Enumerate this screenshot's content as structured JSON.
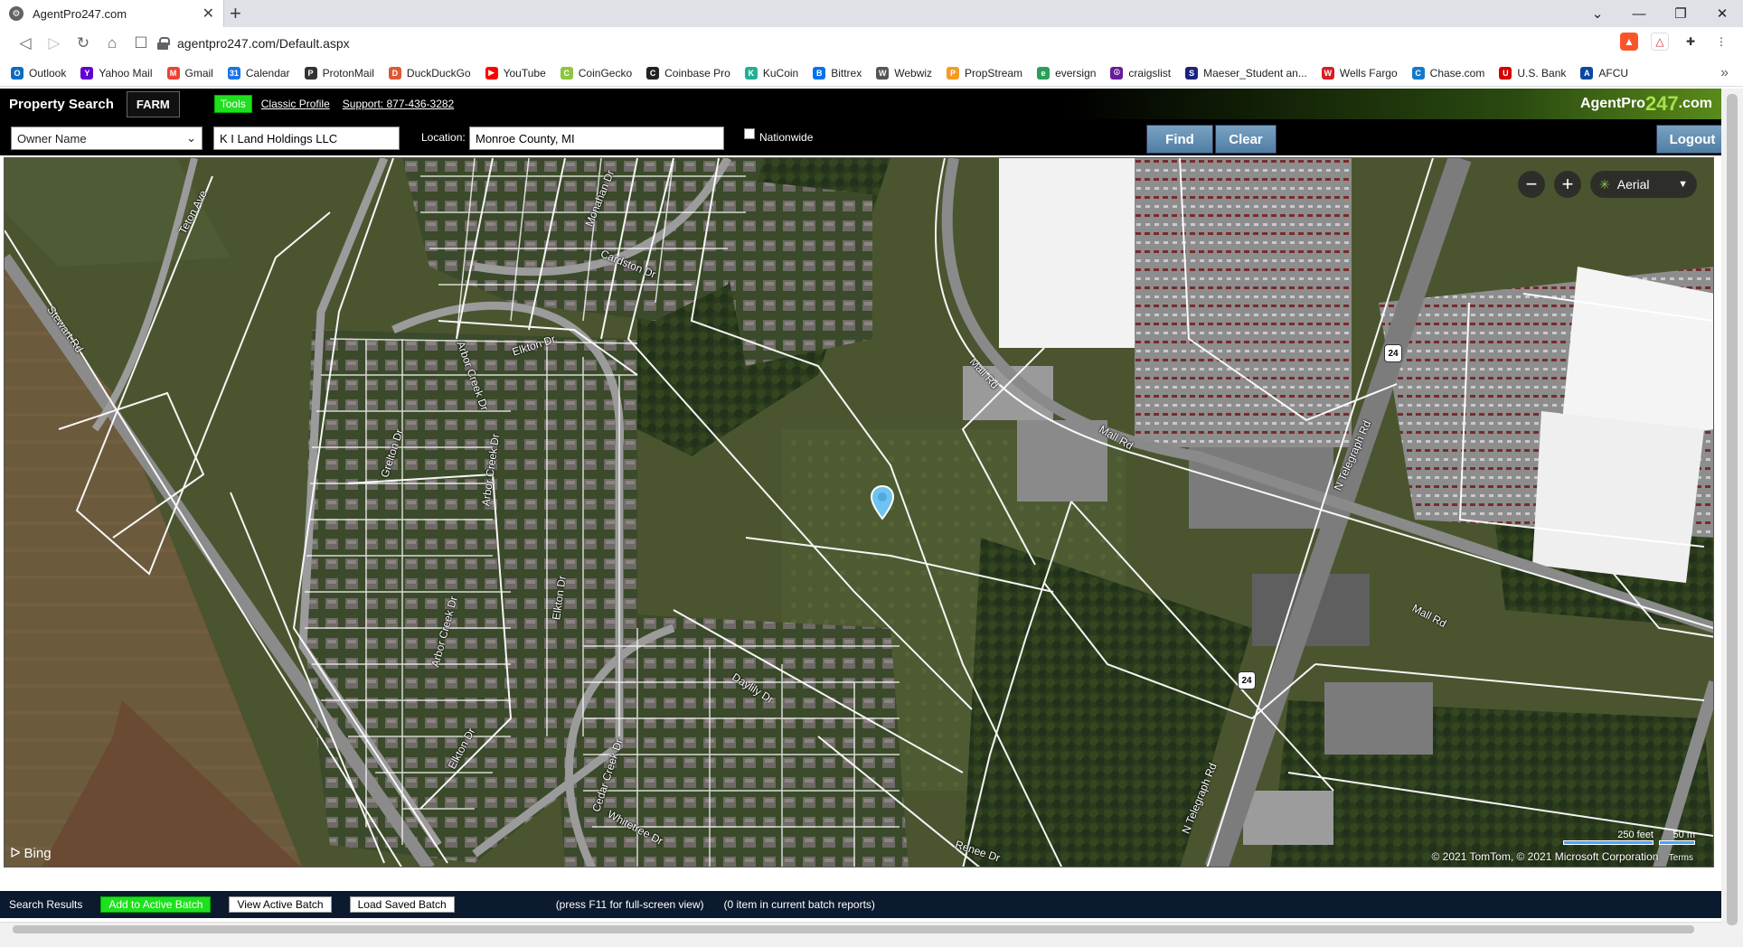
{
  "browser": {
    "tab_title": "AgentPro247.com",
    "url": "agentpro247.com/Default.aspx",
    "bookmarks": [
      {
        "label": "Outlook",
        "color": "#0f6cbd",
        "glyph": "O"
      },
      {
        "label": "Yahoo Mail",
        "color": "#6001d2",
        "glyph": "Y"
      },
      {
        "label": "Gmail",
        "color": "#ea4335",
        "glyph": "M"
      },
      {
        "label": "Calendar",
        "color": "#1a73e8",
        "glyph": "31"
      },
      {
        "label": "ProtonMail",
        "color": "#333333",
        "glyph": "P"
      },
      {
        "label": "DuckDuckGo",
        "color": "#de5833",
        "glyph": "D"
      },
      {
        "label": "YouTube",
        "color": "#ff0000",
        "glyph": "▶"
      },
      {
        "label": "CoinGecko",
        "color": "#8dc63f",
        "glyph": "C"
      },
      {
        "label": "Coinbase Pro",
        "color": "#222222",
        "glyph": "C"
      },
      {
        "label": "KuCoin",
        "color": "#23af91",
        "glyph": "K"
      },
      {
        "label": "Bittrex",
        "color": "#0072ed",
        "glyph": "B"
      },
      {
        "label": "Webwiz",
        "color": "#555555",
        "glyph": "W"
      },
      {
        "label": "PropStream",
        "color": "#f59b21",
        "glyph": "P"
      },
      {
        "label": "eversign",
        "color": "#2c9e5a",
        "glyph": "e"
      },
      {
        "label": "craigslist",
        "color": "#6a1b9a",
        "glyph": "☮"
      },
      {
        "label": "Maeser_Student an...",
        "color": "#1a237e",
        "glyph": "S"
      },
      {
        "label": "Wells Fargo",
        "color": "#d71e28",
        "glyph": "W"
      },
      {
        "label": "Chase.com",
        "color": "#117aca",
        "glyph": "C"
      },
      {
        "label": "U.S. Bank",
        "color": "#d50000",
        "glyph": "U"
      },
      {
        "label": "AFCU",
        "color": "#0d47a1",
        "glyph": "A"
      }
    ]
  },
  "app": {
    "title": "Property Search",
    "farm_label": "FARM",
    "tools_label": "Tools",
    "classic_profile_label": "Classic Profile",
    "support_label": "Support: 877-436-3282",
    "logo_prefix": "AgentPro",
    "logo_number": "247",
    "logo_suffix": ".com"
  },
  "search": {
    "field_type": "Owner Name",
    "query": "K I Land Holdings LLC",
    "location_label": "Location:",
    "location": "Monroe County, MI",
    "nationwide_label": "Nationwide",
    "nationwide_checked": false,
    "find_label": "Find",
    "clear_label": "Clear",
    "logout_label": "Logout"
  },
  "map": {
    "map_type": "Aerial",
    "provider": "Bing",
    "scale_left": "250 feet",
    "scale_right": "50 m",
    "copyright": "© 2021 TomTom, © 2021 Microsoft Corporation",
    "terms": "Terms",
    "road_labels": {
      "stewart": "Stewart Rd",
      "teton": "Teton Ave",
      "monahan": "Monahan Dr",
      "cardston": "Cardston Dr",
      "arbor1": "Arbor Creek Dr",
      "arbor2": "Arbor Creek Dr",
      "arbor3": "Arbor Creek Dr",
      "elkton1": "Elkton Dr",
      "elkton2": "Elkton Dr",
      "elkton3": "Elkton Dr",
      "grelton": "Grelton Dr",
      "daylily": "Daylily Dr",
      "cedar": "Cedar Creek Dr",
      "whitetree": "Whitetree Dr",
      "renee": "Renee Dr",
      "mall1": "Mall Rd",
      "mall2": "Mall Rd",
      "mall3": "Mall Rd",
      "telegraph1": "N Telegraph Rd",
      "telegraph2": "N Telegraph Rd"
    },
    "route_number": "24"
  },
  "results": {
    "label": "Search Results",
    "add_batch": "Add to Active Batch",
    "view_batch": "View Active Batch",
    "load_batch": "Load Saved Batch",
    "hint": "(press F11 for full-screen view)",
    "batch_count": "(0 item in current batch reports)"
  }
}
